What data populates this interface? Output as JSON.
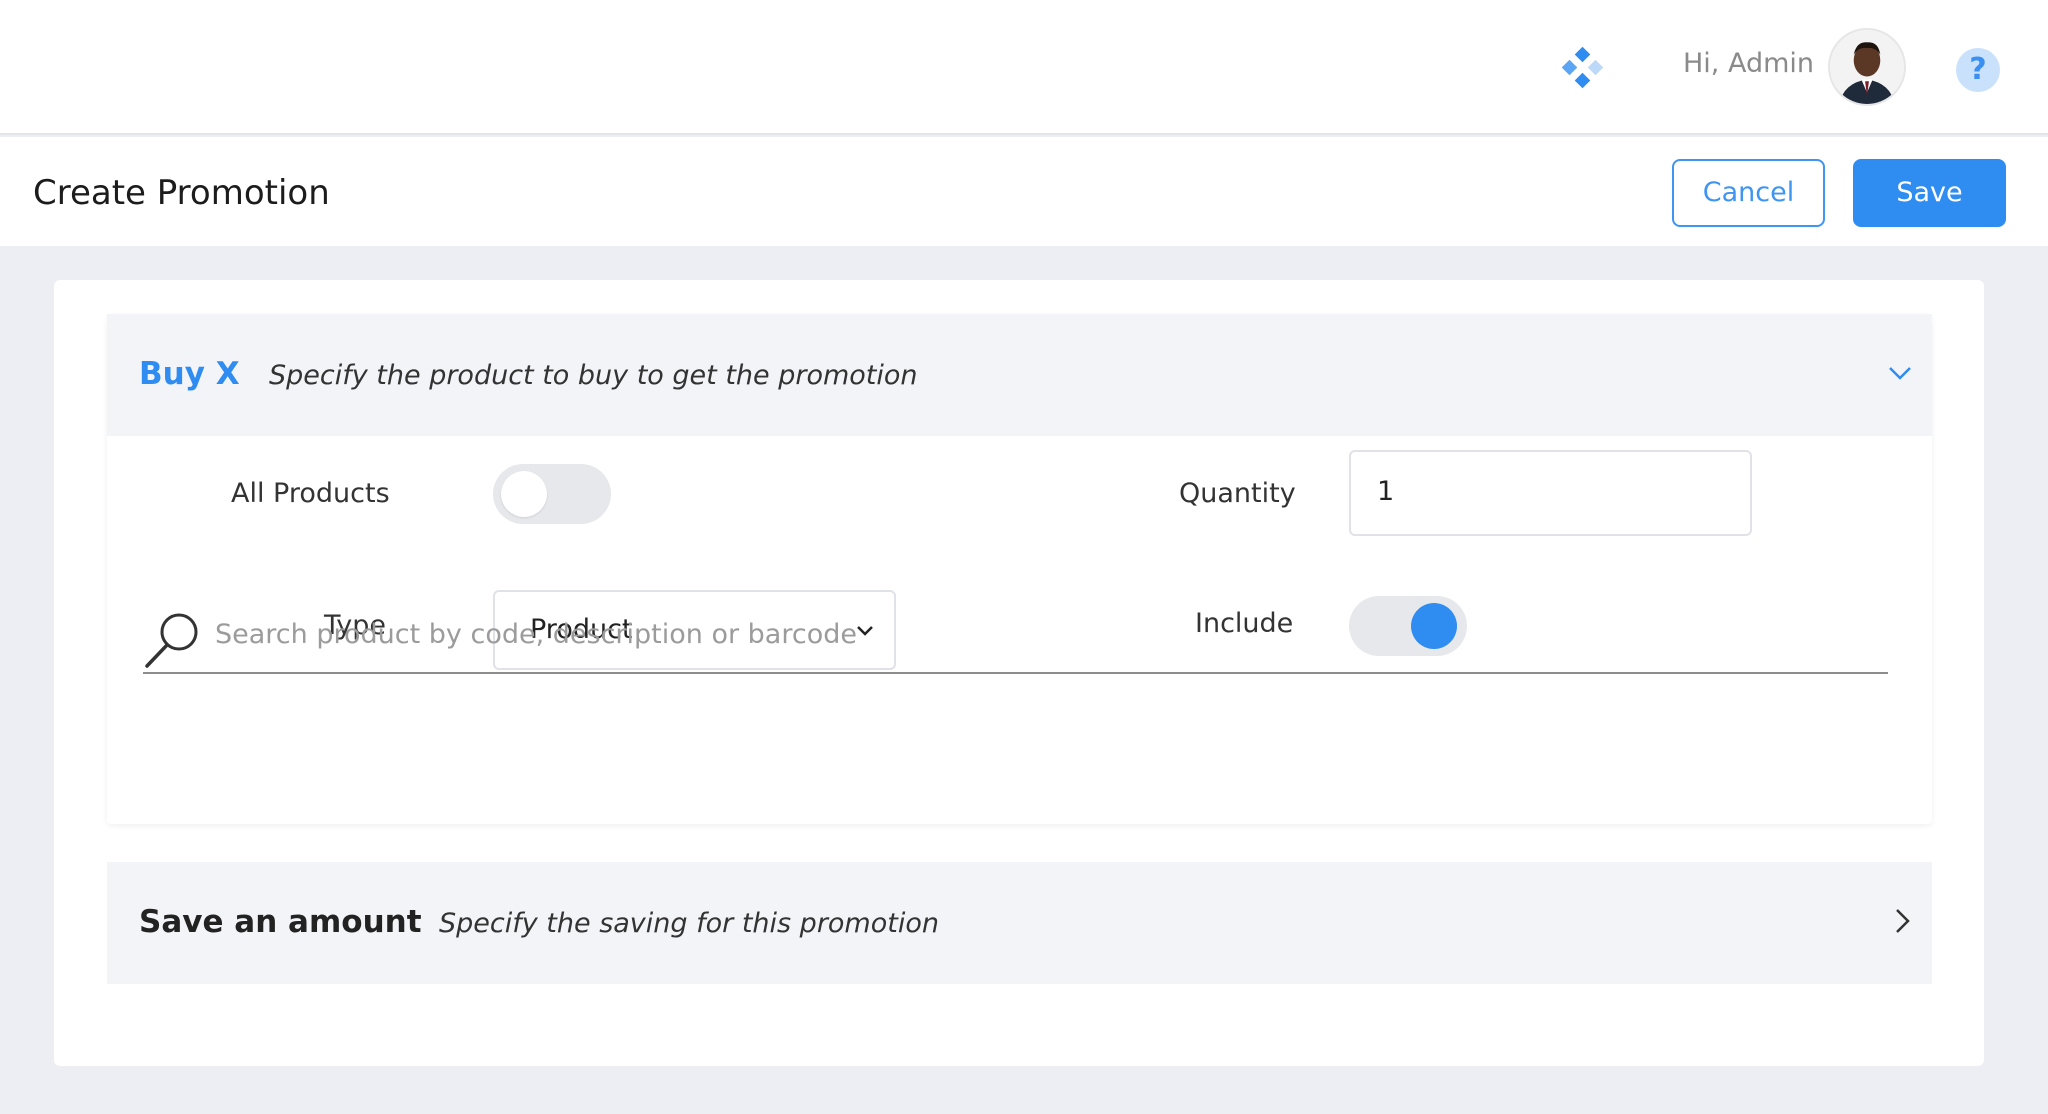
{
  "topbar": {
    "greeting": "Hi, Admin",
    "brand_icon": "diamond-dots-icon",
    "help_glyph": "?",
    "accent": "#2f8cf0"
  },
  "header": {
    "title": "Create Promotion",
    "cancel_label": "Cancel",
    "save_label": "Save"
  },
  "buy_section": {
    "title": "Buy X",
    "description": "Specify the product to buy to get the promotion",
    "expanded": true,
    "all_products_label": "All Products",
    "all_products_on": false,
    "type_label": "Type",
    "type_value": "Product",
    "quantity_label": "Quantity",
    "quantity_value": "1",
    "include_label": "Include",
    "include_on": true,
    "search_placeholder": "Search product by code, description or barcode"
  },
  "save_section": {
    "title": "Save an amount",
    "description": "Specify the saving for this promotion",
    "expanded": false
  }
}
